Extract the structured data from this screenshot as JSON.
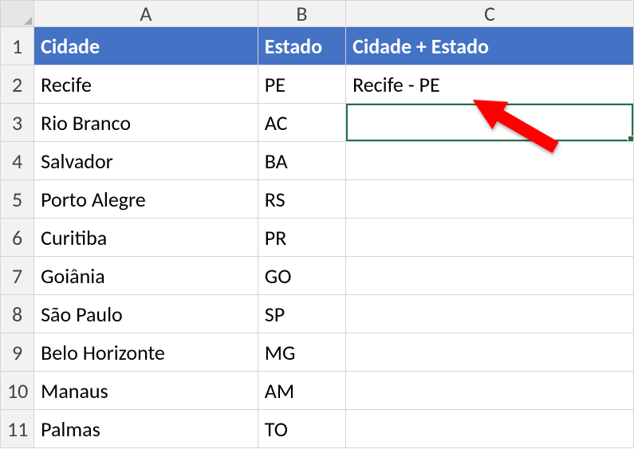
{
  "columns": {
    "A": "A",
    "B": "B",
    "C": "C"
  },
  "headers": {
    "A": "Cidade",
    "B": "Estado",
    "C": "Cidade + Estado"
  },
  "rows": [
    {
      "n": "1"
    },
    {
      "n": "2",
      "A": "Recife",
      "B": "PE",
      "C": "Recife - PE"
    },
    {
      "n": "3",
      "A": "Rio Branco",
      "B": "AC",
      "C": ""
    },
    {
      "n": "4",
      "A": "Salvador",
      "B": "BA",
      "C": ""
    },
    {
      "n": "5",
      "A": "Porto Alegre",
      "B": "RS",
      "C": ""
    },
    {
      "n": "6",
      "A": "Curitiba",
      "B": "PR",
      "C": ""
    },
    {
      "n": "7",
      "A": "Goiânia",
      "B": "GO",
      "C": ""
    },
    {
      "n": "8",
      "A": "São Paulo",
      "B": "SP",
      "C": ""
    },
    {
      "n": "9",
      "A": "Belo Horizonte",
      "B": "MG",
      "C": ""
    },
    {
      "n": "10",
      "A": "Manaus",
      "B": "AM",
      "C": ""
    },
    {
      "n": "11",
      "A": "Palmas",
      "B": "TO",
      "C": ""
    }
  ],
  "selected_cell": "C3"
}
